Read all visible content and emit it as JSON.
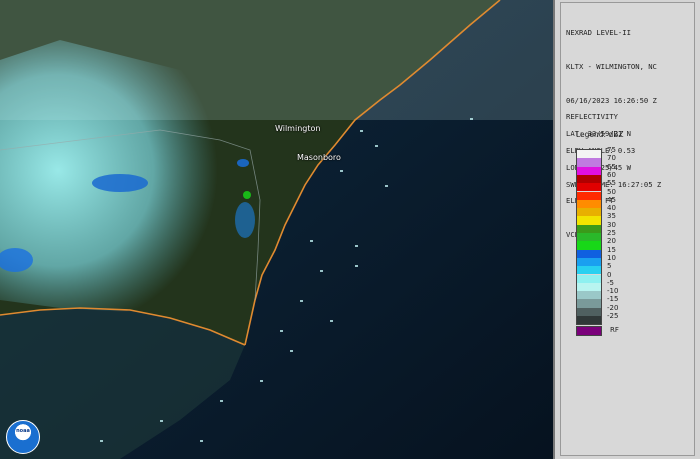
{
  "map": {
    "cities": [
      {
        "name": "Wilmington"
      },
      {
        "name": "Masonboro"
      }
    ],
    "logo_text": "noaa"
  },
  "info": {
    "lines": [
      "NEXRAD LEVEL-II",
      "KLTX - WILMINGTON, NC",
      "06/16/2023 16:26:50 Z",
      "LAT: 33/59/21 N",
      "LON: 78/25/45 W",
      "ELEV: 64 FT",
      "VCP: 215"
    ],
    "lines2": [
      "REFLECTIVITY",
      "ELEV ANGLE: 0.53",
      "SWEEP TIME: 16:27:05 Z"
    ]
  },
  "legend": {
    "title": "Legend: dBZ",
    "rf_label": "RF",
    "entries": [
      {
        "label": "75",
        "color": "#f4f4f4"
      },
      {
        "label": "70",
        "color": "#c07ae0"
      },
      {
        "label": "65",
        "color": "#e010e0"
      },
      {
        "label": "60",
        "color": "#b00000"
      },
      {
        "label": "55",
        "color": "#e00000"
      },
      {
        "label": "50",
        "color": "#ff2a00"
      },
      {
        "label": "45",
        "color": "#ff8c00"
      },
      {
        "label": "40",
        "color": "#e8b000"
      },
      {
        "label": "35",
        "color": "#f2e400"
      },
      {
        "label": "30",
        "color": "#3a9a1a"
      },
      {
        "label": "25",
        "color": "#2ab82a"
      },
      {
        "label": "20",
        "color": "#18d818"
      },
      {
        "label": "15",
        "color": "#1060e0"
      },
      {
        "label": "10",
        "color": "#1aa0f0"
      },
      {
        "label": "5",
        "color": "#28d0f0"
      },
      {
        "label": "0",
        "color": "#8ef0f0"
      },
      {
        "label": "-5",
        "color": "#b8f4f0"
      },
      {
        "label": "-10",
        "color": "#9ac8c8"
      },
      {
        "label": "-15",
        "color": "#7a9a9a"
      },
      {
        "label": "-20",
        "color": "#506060"
      },
      {
        "label": "-25",
        "color": "#303838"
      }
    ]
  }
}
